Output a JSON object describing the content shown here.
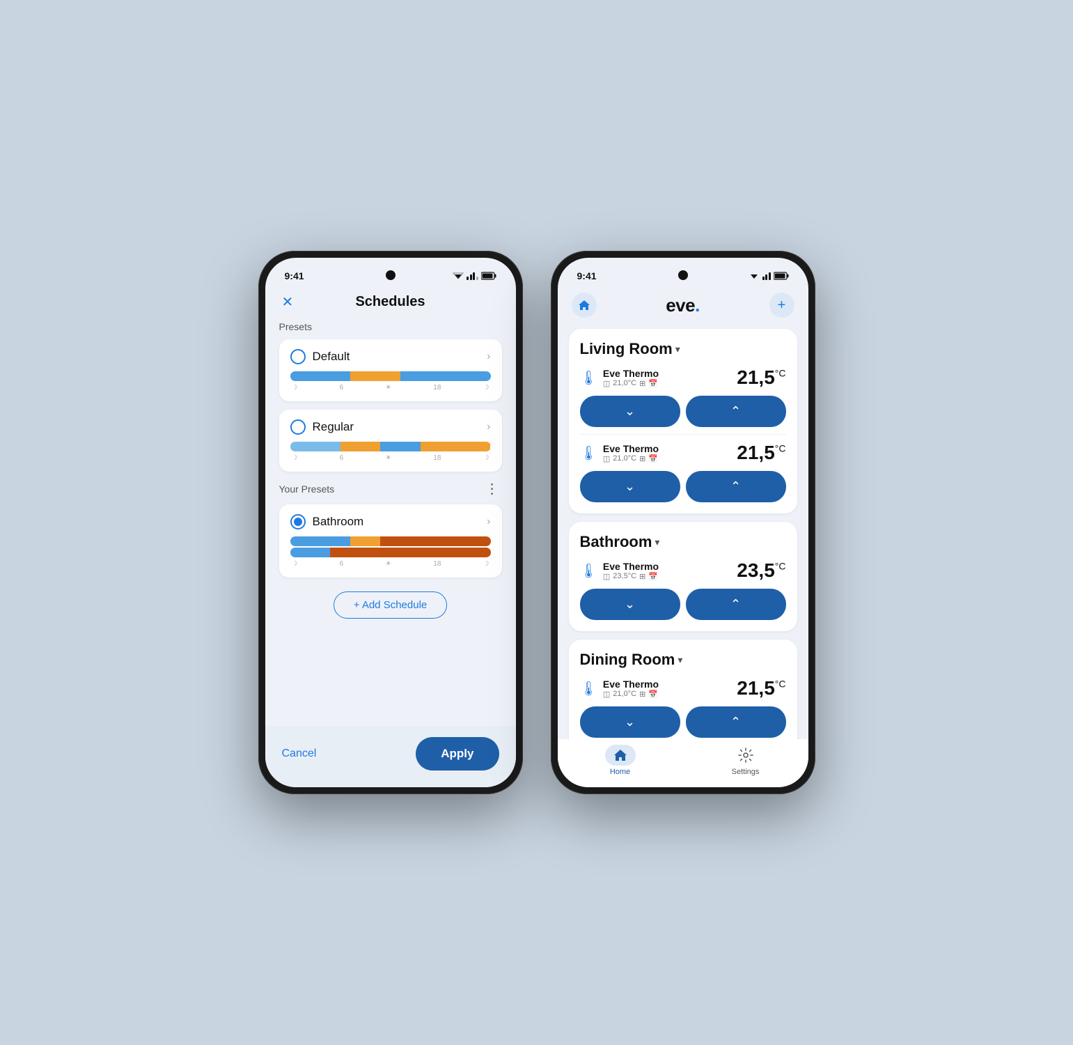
{
  "phone1": {
    "status": {
      "time": "9:41",
      "wifi": "▼▲",
      "signal": "▲"
    },
    "header": {
      "title": "Schedules",
      "close_label": "✕"
    },
    "presets_label": "Presets",
    "presets": [
      {
        "name": "Default",
        "selected": false,
        "bar": [
          {
            "color": "#4a9de0",
            "flex": 30
          },
          {
            "color": "#f0a030",
            "flex": 25
          },
          {
            "color": "#4a9de0",
            "flex": 45
          }
        ],
        "bar_labels": [
          "☽",
          "6",
          "☀",
          "18",
          "☽"
        ]
      },
      {
        "name": "Regular",
        "selected": false,
        "bar": [
          {
            "color": "#7abce8",
            "flex": 25
          },
          {
            "color": "#f0a030",
            "flex": 20
          },
          {
            "color": "#4a9de0",
            "flex": 20
          },
          {
            "color": "#f0a030",
            "flex": 35
          }
        ],
        "bar_labels": [
          "☽",
          "6",
          "☀",
          "18",
          "☽"
        ]
      }
    ],
    "your_presets_label": "Your Presets",
    "your_presets": [
      {
        "name": "Bathroom",
        "selected": true,
        "bar_top": [
          {
            "color": "#4a9de0",
            "flex": 30
          },
          {
            "color": "#f0a030",
            "flex": 15
          },
          {
            "color": "#c05010",
            "flex": 55
          }
        ],
        "bar_bottom": [
          {
            "color": "#4a9de0",
            "flex": 20
          },
          {
            "color": "#c05010",
            "flex": 80
          }
        ],
        "bar_labels": [
          "☽",
          "6",
          "☀",
          "18",
          "☽"
        ]
      }
    ],
    "add_schedule_label": "+ Add Schedule",
    "footer": {
      "cancel_label": "Cancel",
      "apply_label": "Apply"
    }
  },
  "phone2": {
    "status": {
      "time": "9:41"
    },
    "header": {
      "logo": "eve.",
      "home_icon": "⌂",
      "add_icon": "+"
    },
    "rooms": [
      {
        "name": "Living Room",
        "devices": [
          {
            "name": "Eve Thermo",
            "sub_temp": "21,0°C",
            "temp": "21,5",
            "unit": "°C"
          },
          {
            "name": "Eve Thermo",
            "sub_temp": "21,0°C",
            "temp": "21,5",
            "unit": "°C"
          }
        ]
      },
      {
        "name": "Bathroom",
        "devices": [
          {
            "name": "Eve Thermo",
            "sub_temp": "23,5°C",
            "temp": "23,5",
            "unit": "°C"
          }
        ]
      },
      {
        "name": "Dining Room",
        "devices": [
          {
            "name": "Eve Thermo",
            "sub_temp": "21,0°C",
            "temp": "21,5",
            "unit": "°C"
          }
        ]
      }
    ],
    "nav": [
      {
        "label": "Home",
        "icon": "🏠",
        "active": true
      },
      {
        "label": "Settings",
        "icon": "⚙",
        "active": false
      }
    ]
  }
}
